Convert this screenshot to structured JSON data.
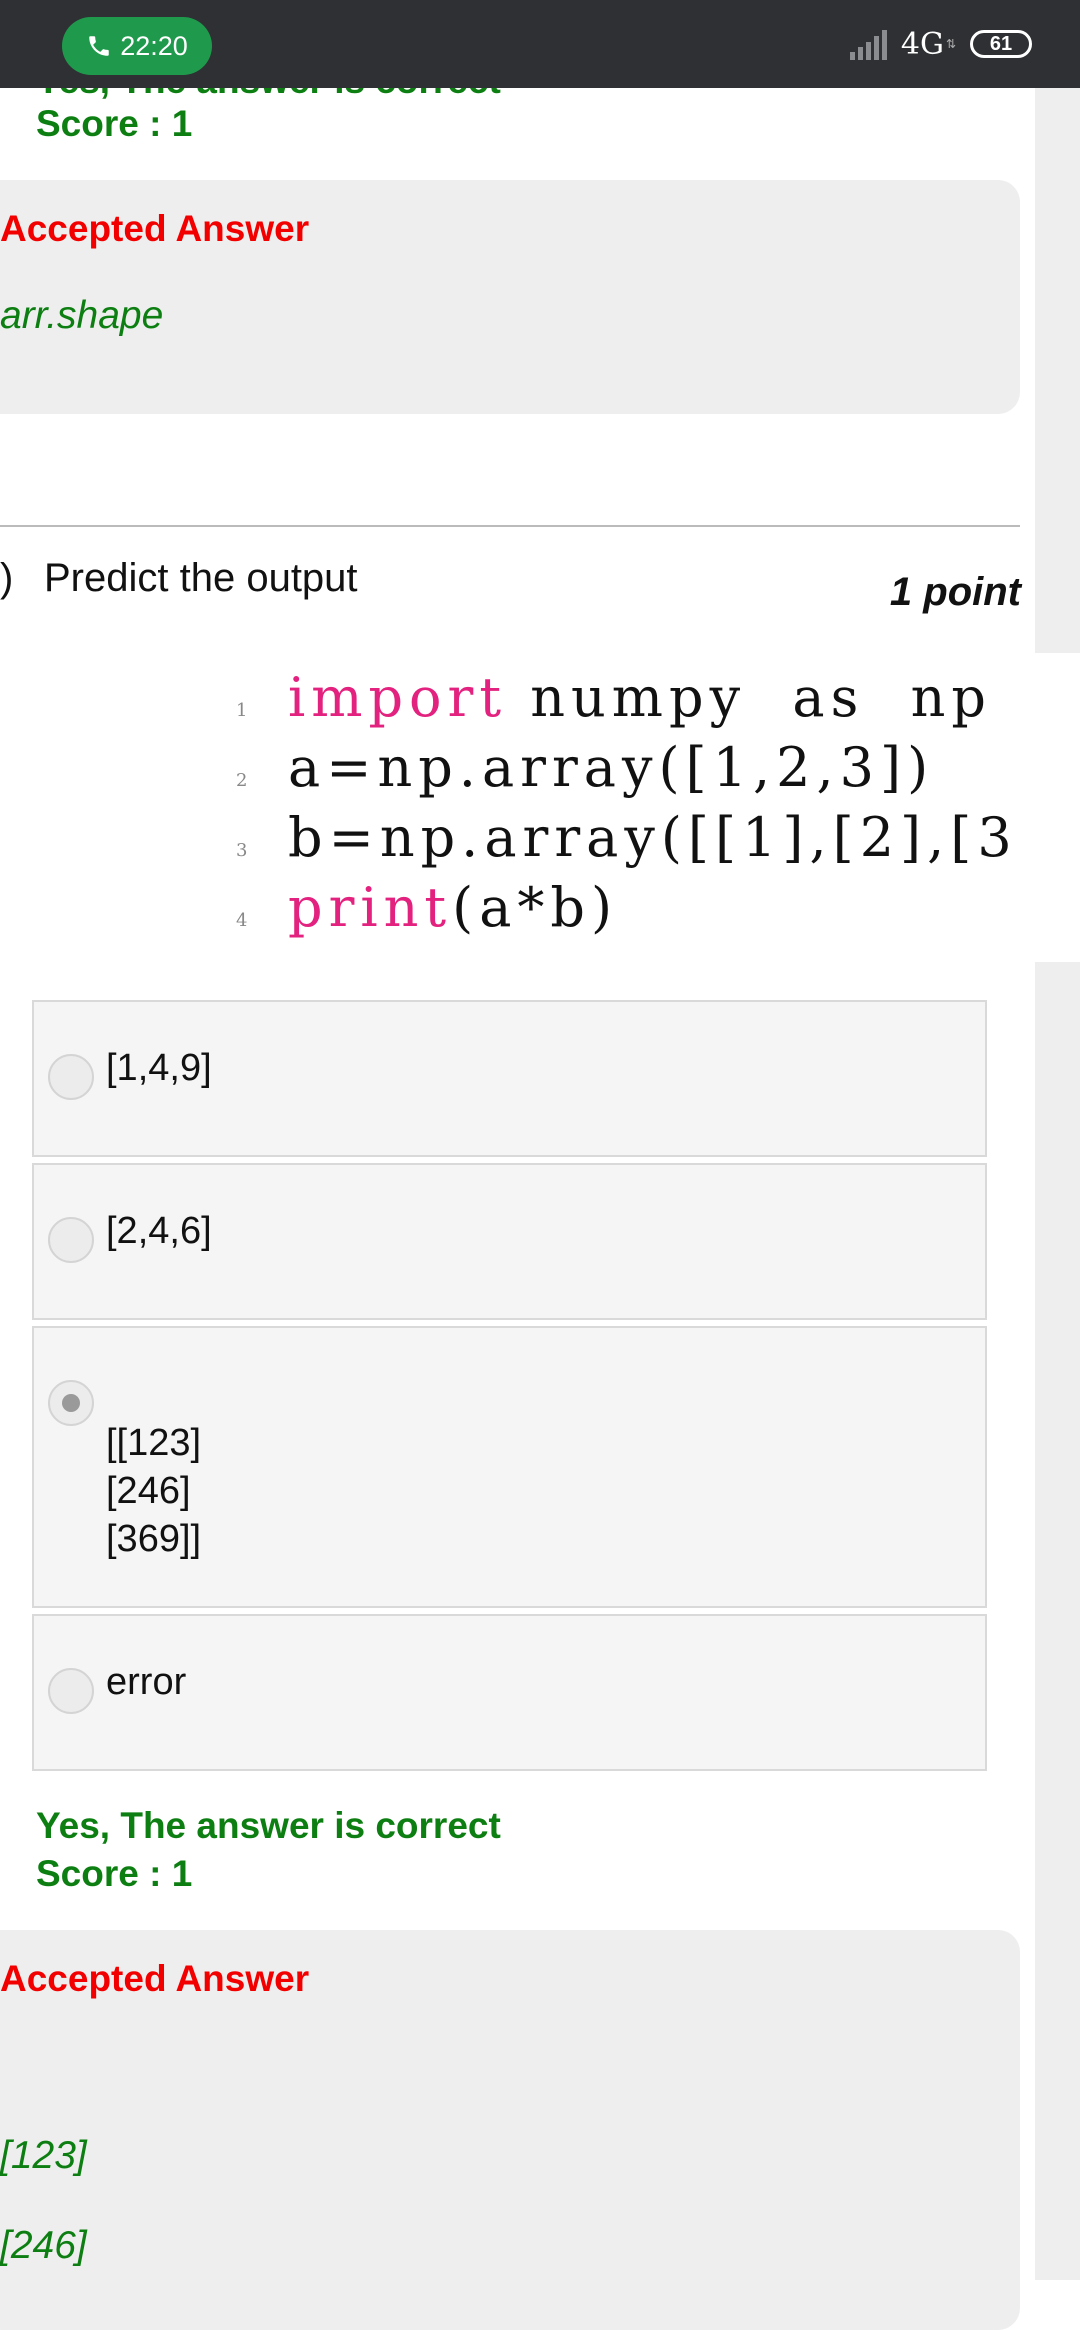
{
  "status_bar": {
    "time": "22:20",
    "network": "4G",
    "battery": "61"
  },
  "previous_question": {
    "result_text_cut": "Yes, The answer is correct",
    "score": "Score : 1",
    "accepted_answer_title": "Accepted Answer",
    "accepted_answer": "arr.shape"
  },
  "question": {
    "number_fragment": ")",
    "prompt": "Predict the output",
    "points": "1 point",
    "code_lines": [
      {
        "num": "1",
        "kw": "import",
        "rest": " numpy  as  np"
      },
      {
        "num": "2",
        "kw": "",
        "rest": "a=np.array([1,2,3])"
      },
      {
        "num": "3",
        "kw": "",
        "rest": "b=np.array([[1],[2],[3"
      },
      {
        "num": "4",
        "kw": "print",
        "rest": "(a*b)"
      }
    ],
    "options": [
      {
        "label": "[1,4,9]",
        "selected": false
      },
      {
        "label": "[2,4,6]",
        "selected": false
      },
      {
        "label": "[[123]\n[246]\n[369]]",
        "selected": true
      },
      {
        "label": "error",
        "selected": false
      }
    ],
    "result_text": "Yes, The answer is correct",
    "score": "Score : 1",
    "accepted_answer_title": "Accepted Answer",
    "accepted_answer_lines": [
      "[123]",
      "[246]"
    ]
  },
  "colors": {
    "correct_green": "#0d7f12",
    "accepted_red": "#f20000",
    "code_keyword": "#e3217e"
  }
}
